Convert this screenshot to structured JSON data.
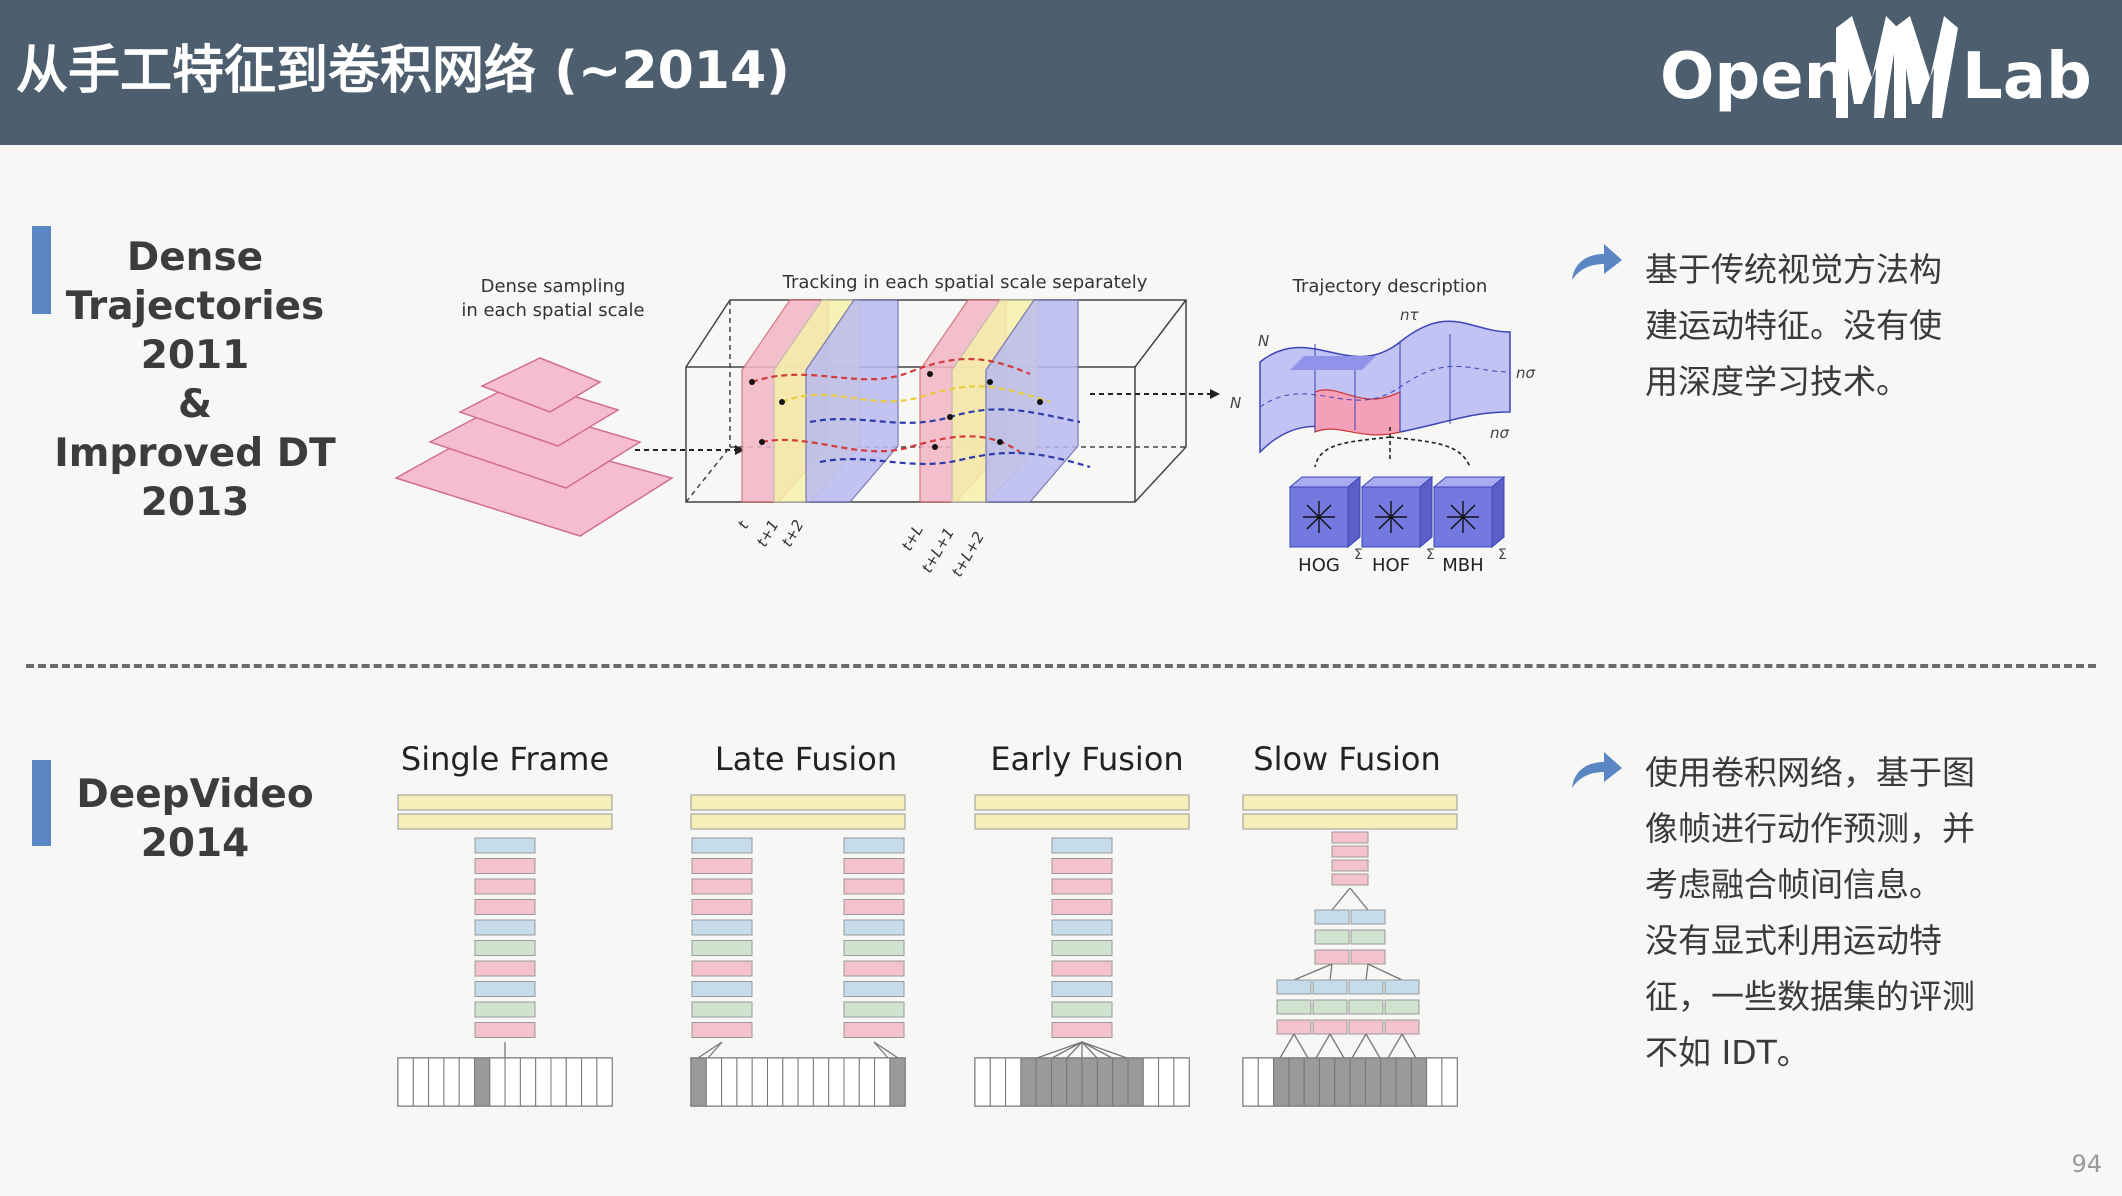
{
  "header": {
    "title": "从手工特征到卷积网络 (~2014)",
    "logo_parts": [
      "Open",
      "Lab"
    ]
  },
  "section1": {
    "label_lines": [
      "Dense",
      "Trajectories",
      "2011",
      "&",
      "Improved DT",
      "2013"
    ],
    "figure": {
      "sampling_caption_1": "Dense sampling",
      "sampling_caption_2": "in each spatial scale",
      "tracking_caption": "Tracking in each spatial scale separately",
      "description_caption": "Trajectory description",
      "descriptors": [
        "HOG",
        "HOF",
        "MBH"
      ],
      "sym_N": "N",
      "sym_ntau": "nτ",
      "sym_nsigma": "nσ",
      "sym_sigma": "Σ",
      "frame_ticks": [
        "t",
        "t+1",
        "t+2",
        "t+L",
        "t+L+1",
        "t+L+2"
      ]
    },
    "description_lines": [
      "基于传统视觉方法构",
      "建运动特征。没有使",
      "用深度学习技术。"
    ]
  },
  "section2": {
    "label_lines": [
      "DeepVideo",
      "2014"
    ],
    "column_titles": [
      "Single Frame",
      "Late Fusion",
      "Early Fusion",
      "Slow Fusion"
    ],
    "description_lines": [
      "使用卷积网络，基于图",
      "像帧进行动作预测，并",
      "考虑融合帧间信息。",
      "没有显式利用运动特",
      "征，一些数据集的评测",
      "不如 IDT。"
    ]
  },
  "colors": {
    "header": "#4d5e6f",
    "accent_bar": "#5b86c4",
    "pink": "#f4c2cc",
    "yellow": "#f5f0b8",
    "blue": "#c5c8f2",
    "green": "#cfe3cf",
    "light_blue": "#c6dcea"
  },
  "icons": [
    "curved-arrow-icon"
  ],
  "page_number": "94"
}
